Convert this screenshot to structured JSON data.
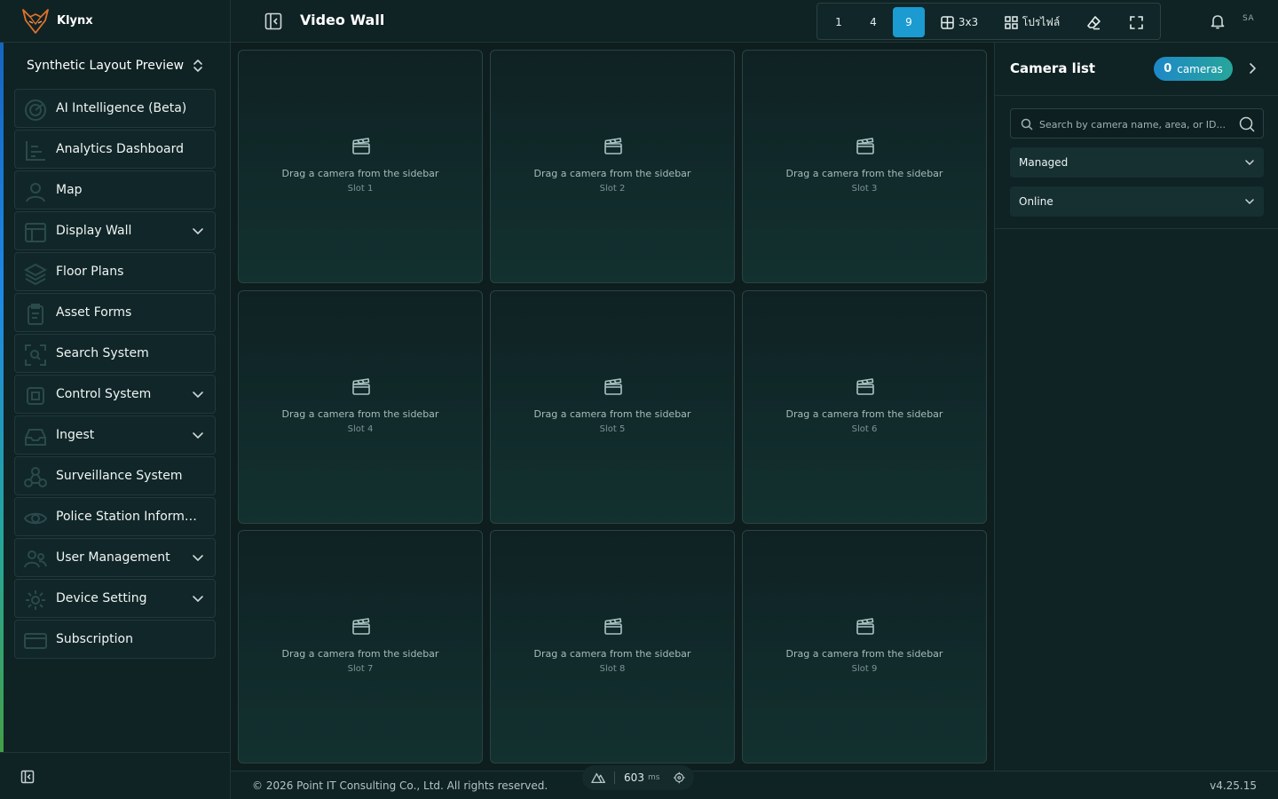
{
  "app": {
    "name": "Klynx"
  },
  "sidebar": {
    "workspace": "Synthetic Layout Preview",
    "items": [
      {
        "label": "AI Intelligence (Beta)",
        "icon": "radar-icon",
        "expandable": false
      },
      {
        "label": "Analytics Dashboard",
        "icon": "chart-icon",
        "expandable": false
      },
      {
        "label": "Map",
        "icon": "map-pin-icon",
        "expandable": false
      },
      {
        "label": "Display Wall",
        "icon": "layout-icon",
        "expandable": true
      },
      {
        "label": "Floor Plans",
        "icon": "layers-icon",
        "expandable": false
      },
      {
        "label": "Asset Forms",
        "icon": "clipboard-icon",
        "expandable": false
      },
      {
        "label": "Search System",
        "icon": "scan-icon",
        "expandable": false
      },
      {
        "label": "Control System",
        "icon": "chip-icon",
        "expandable": true
      },
      {
        "label": "Ingest",
        "icon": "inbox-icon",
        "expandable": true
      },
      {
        "label": "Surveillance System",
        "icon": "network-icon",
        "expandable": false
      },
      {
        "label": "Police Station Informati...",
        "icon": "eye-icon",
        "expandable": false
      },
      {
        "label": "User Management",
        "icon": "users-icon",
        "expandable": true
      },
      {
        "label": "Device Setting",
        "icon": "gear-icon",
        "expandable": true
      },
      {
        "label": "Subscription",
        "icon": "card-icon",
        "expandable": false
      }
    ]
  },
  "header": {
    "title": "Video Wall",
    "layout_buttons": [
      {
        "label": "1",
        "active": false
      },
      {
        "label": "4",
        "active": false
      },
      {
        "label": "9",
        "active": true
      }
    ],
    "grid_label": "3x3",
    "profile_label": "โปรไฟล์",
    "user_initials": "SA"
  },
  "wall": {
    "slots": [
      {
        "hint": "Drag a camera from the sidebar",
        "name": "Slot 1"
      },
      {
        "hint": "Drag a camera from the sidebar",
        "name": "Slot 2"
      },
      {
        "hint": "Drag a camera from the sidebar",
        "name": "Slot 3"
      },
      {
        "hint": "Drag a camera from the sidebar",
        "name": "Slot 4"
      },
      {
        "hint": "Drag a camera from the sidebar",
        "name": "Slot 5"
      },
      {
        "hint": "Drag a camera from the sidebar",
        "name": "Slot 6"
      },
      {
        "hint": "Drag a camera from the sidebar",
        "name": "Slot 7"
      },
      {
        "hint": "Drag a camera from the sidebar",
        "name": "Slot 8"
      },
      {
        "hint": "Drag a camera from the sidebar",
        "name": "Slot 9"
      }
    ]
  },
  "camera_panel": {
    "title": "Camera list",
    "count": "0",
    "count_unit": "cameras",
    "search_placeholder": "Search by camera name, area, or ID...",
    "filter_managed": "Managed",
    "filter_status": "Online"
  },
  "footer": {
    "copyright": "© 2026 Point IT Consulting Co., Ltd. All rights reserved.",
    "latency_value": "603",
    "latency_unit": "ms",
    "version": "v4.25.15"
  },
  "colors": {
    "accent": "#1b9bd1",
    "background": "#0e1e1f",
    "badge_gradient_start": "#1e88c8",
    "badge_gradient_end": "#26a69a"
  }
}
